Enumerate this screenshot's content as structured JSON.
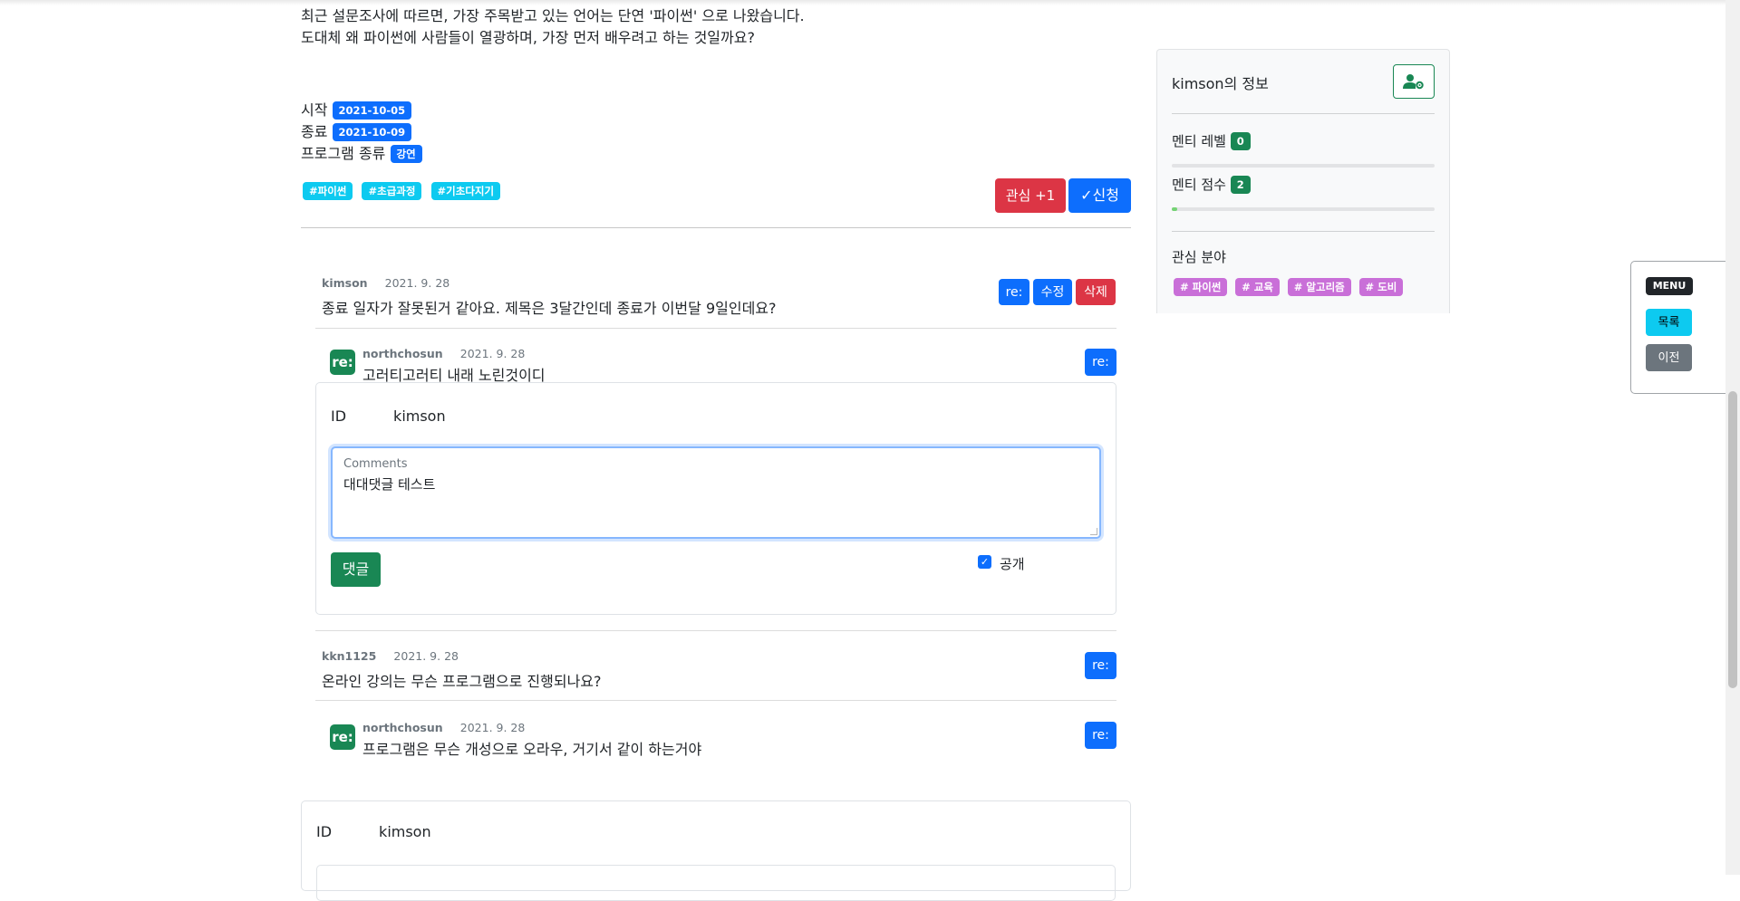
{
  "post": {
    "intro_line1": "최근 설문조사에 따르면, 가장 주목받고 있는 언어는 단연 '파이썬' 으로 나왔습니다.",
    "intro_line2": "도대체 왜 파이썬에 사람들이 열광하며, 가장 먼저 배우려고 하는 것일까요?",
    "start_label": "시작",
    "start_date": "2021-10-05",
    "end_label": "종료",
    "end_date": "2021-10-09",
    "type_label": "프로그램 종류",
    "type_value": "강연",
    "tags": [
      "#파이썬",
      "#초급과정",
      "#기초다지기"
    ],
    "interest_label": "관심 +1",
    "apply_label": "✓신청"
  },
  "comments": [
    {
      "author": "kimson",
      "date": "2021. 9. 28",
      "text": "종료 일자가 잘못된거 같아요. 제목은 3달간인데 종료가 이번달 9일인데요?",
      "re_label": "re:",
      "edit_label": "수정",
      "delete_label": "삭제"
    },
    {
      "author": "northchosun",
      "date": "2021. 9. 28",
      "text": "고러티고러티 내래 노린것이디",
      "re_label": "re:",
      "badge": "re:"
    },
    {
      "author": "kkn1125",
      "date": "2021. 9. 28",
      "text": "온라인 강의는 무슨 프로그램으로 진행되나요?",
      "re_label": "re:"
    },
    {
      "author": "northchosun",
      "date": "2021. 9. 28",
      "text": "프로그램은 무슨 개성으로 오라우, 거기서 같이 하는거야",
      "re_label": "re:",
      "badge": "re:"
    }
  ],
  "reply_form": {
    "id_label": "ID",
    "id_value": "kimson",
    "comments_label": "Comments",
    "comments_value": "대대댓글 테스트",
    "submit_label": "댓글",
    "public_label": "공개",
    "public_checked": true
  },
  "bottom_form": {
    "id_label": "ID",
    "id_value": "kimson"
  },
  "sidebar": {
    "title": "kimson의 정보",
    "gear_icon": "user-gear-icon",
    "mentee_level_label": "멘티 레벨",
    "mentee_level": "0",
    "mentee_level_progress": 0,
    "mentee_score_label": "멘티 점수",
    "mentee_score": "2",
    "mentee_score_progress": 0.02,
    "interest_label": "관심 분야",
    "interests": [
      "# 파이썬",
      "# 교육",
      "# 알고리즘",
      "# 도비"
    ]
  },
  "menu": {
    "title": "MENU",
    "list_label": "목록",
    "prev_label": "이전"
  },
  "colors": {
    "primary": "#0d6efd",
    "info": "#0dcaf0",
    "success": "#198754",
    "danger": "#dc3545",
    "secondary": "#6c757d",
    "tag_purple": "#c96fd8"
  }
}
